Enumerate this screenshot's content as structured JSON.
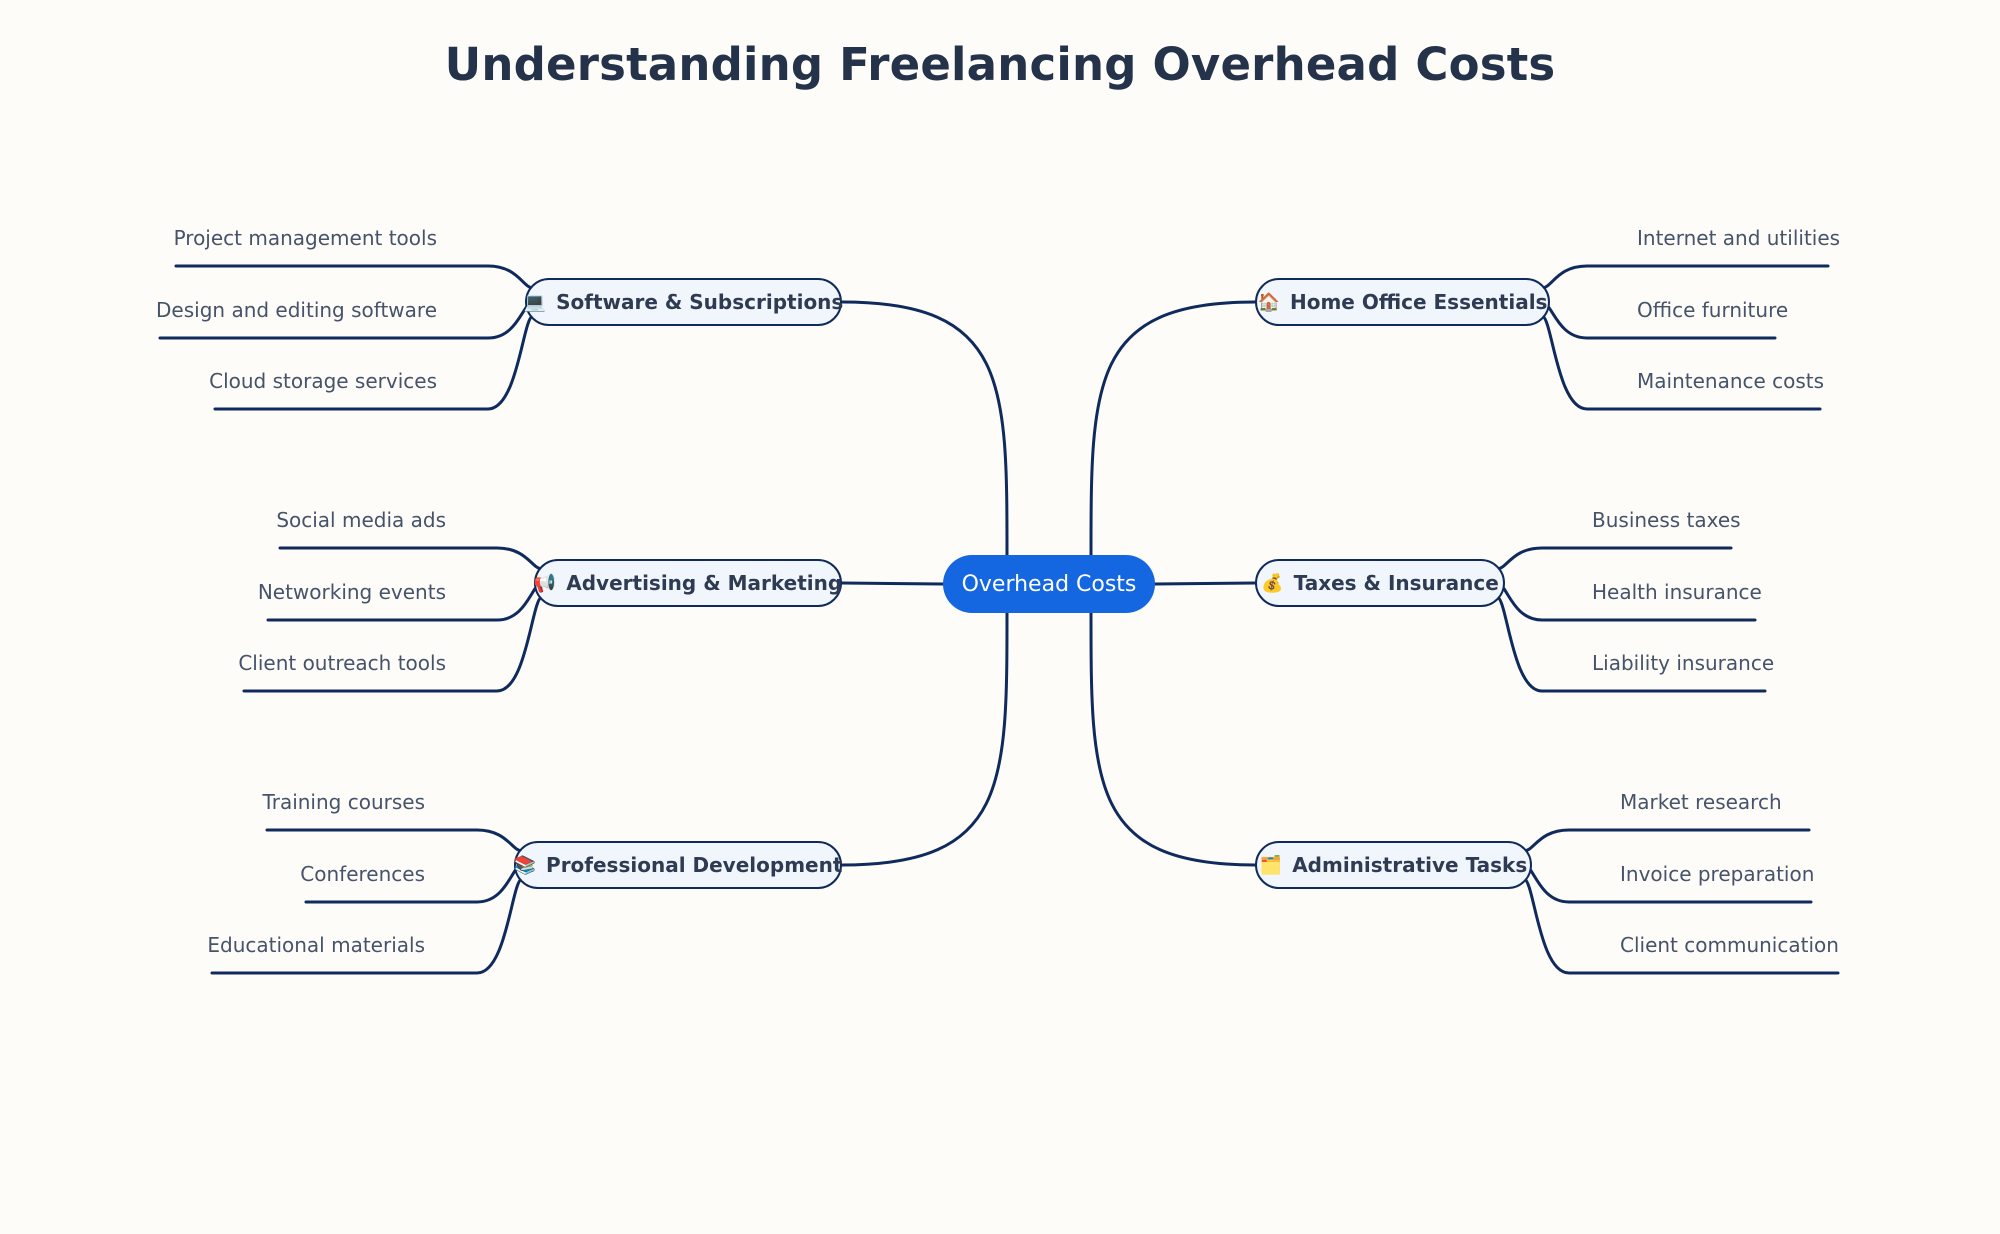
{
  "title": "Understanding Freelancing Overhead Costs",
  "root": {
    "label": "Overhead Costs",
    "color": "#1467e0"
  },
  "line_color": "#0f2a5c",
  "branches": [
    {
      "id": "software",
      "side": "left",
      "icon": "laptop-icon",
      "glyph": "💻",
      "label": "Software & Subscriptions",
      "children": [
        "Project management tools",
        "Design and editing software",
        "Cloud storage services"
      ]
    },
    {
      "id": "advertising",
      "side": "left",
      "icon": "megaphone-icon",
      "glyph": "📢",
      "label": "Advertising & Marketing",
      "children": [
        "Social media ads",
        "Networking events",
        "Client outreach tools"
      ]
    },
    {
      "id": "professional",
      "side": "left",
      "icon": "books-icon",
      "glyph": "📚",
      "label": "Professional Development",
      "children": [
        "Training courses",
        "Conferences",
        "Educational materials"
      ]
    },
    {
      "id": "home-office",
      "side": "right",
      "icon": "house-icon",
      "glyph": "🏠",
      "label": "Home Office Essentials",
      "children": [
        "Internet and utilities",
        "Office furniture",
        "Maintenance costs"
      ]
    },
    {
      "id": "taxes",
      "side": "right",
      "icon": "money-bag-icon",
      "glyph": "💰",
      "label": "Taxes & Insurance",
      "children": [
        "Business taxes",
        "Health insurance",
        "Liability insurance"
      ]
    },
    {
      "id": "admin",
      "side": "right",
      "icon": "folder-icon",
      "glyph": "🗂️",
      "label": "Administrative Tasks",
      "children": [
        "Market research",
        "Invoice preparation",
        "Client communication"
      ]
    }
  ]
}
